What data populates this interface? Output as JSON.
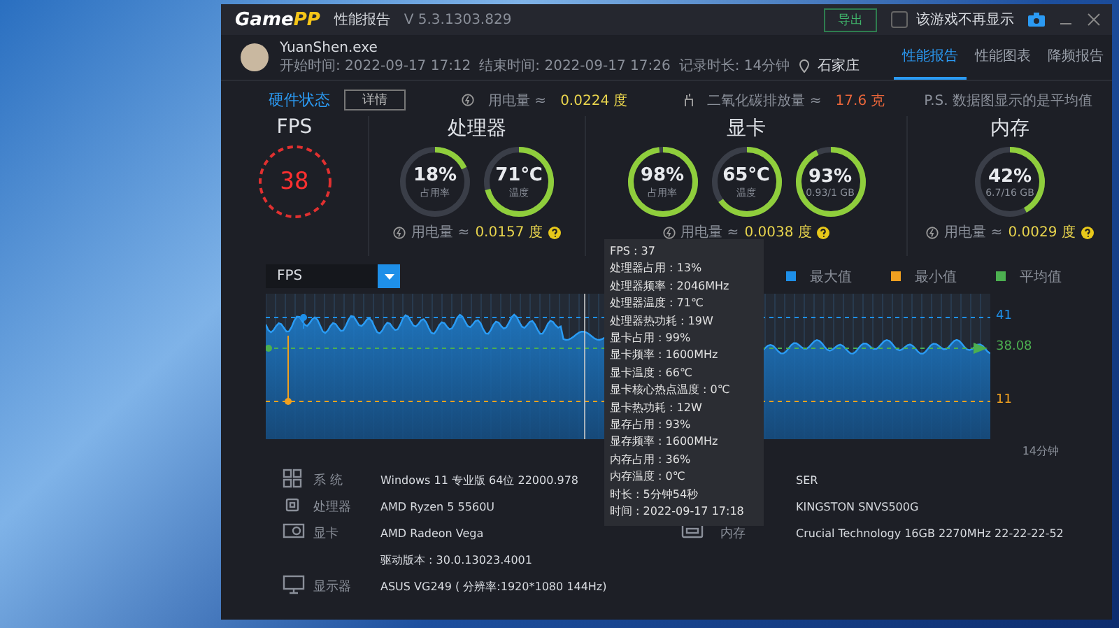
{
  "window": {
    "logo_left": "Game",
    "logo_right": "PP",
    "title": "性能报告",
    "version": "V 5.3.1303.829",
    "export_button": "导出",
    "dont_show": {
      "label": "该游戏不再显示",
      "checked": false
    }
  },
  "session": {
    "exe": "YuanShen.exe",
    "start": "开始时间: 2022-09-17 17:12",
    "end": "结束时间: 2022-09-17 17:26",
    "duration": "记录时长: 14分钟",
    "location": "石家庄"
  },
  "tabs": [
    {
      "label": "性能报告",
      "selected": true
    },
    {
      "label": "性能图表",
      "selected": false
    },
    {
      "label": "降频报告",
      "selected": false
    }
  ],
  "hardware": {
    "title": "硬件状态",
    "details_button": "详情",
    "power_label": "用电量 ≈",
    "power_value": "0.0224 度",
    "co2_label": "二氧化碳排放量 ≈",
    "co2_value": "17.6 克",
    "note": "P.S. 数据图显示的是平均值"
  },
  "fps": {
    "title": "FPS",
    "value": "38"
  },
  "groups": [
    {
      "title": "处理器",
      "power_label": "用电量 ≈",
      "power_value": "0.0157 度",
      "gauges": [
        {
          "value": "18%",
          "caption": "占用率",
          "level": 0.18
        },
        {
          "value": "71℃",
          "caption": "温度",
          "level": 0.71
        }
      ]
    },
    {
      "title": "显卡",
      "power_label": "用电量 ≈",
      "power_value": "0.0038 度",
      "gauges": [
        {
          "value": "98%",
          "caption": "占用率",
          "level": 0.98
        },
        {
          "value": "65℃",
          "caption": "温度",
          "level": 0.65
        },
        {
          "value": "93%",
          "caption": "0.93/1 GB",
          "level": 0.93
        }
      ]
    },
    {
      "title": "内存",
      "power_label": "用电量 ≈",
      "power_value": "0.0029 度",
      "gauges": [
        {
          "value": "42%",
          "caption": "6.7/16 GB",
          "level": 0.42
        }
      ]
    }
  ],
  "chart": {
    "metric": "FPS",
    "legend": [
      {
        "label": "最大值",
        "color": "#1e8fe8"
      },
      {
        "label": "最小值",
        "color": "#f0a020"
      },
      {
        "label": "平均值",
        "color": "#4cb050"
      }
    ],
    "max_label": "41",
    "avg_label": "38.08",
    "min_label": "11",
    "end_label": "14分钟"
  },
  "tooltip": [
    "FPS : 37",
    "处理器占用 : 13%",
    "处理器频率 : 2046MHz",
    "处理器温度 : 71℃",
    "处理器热功耗 : 19W",
    "显卡占用 : 99%",
    "显卡频率 : 1600MHz",
    "显卡温度 : 66℃",
    "显卡核心热点温度 : 0℃",
    "显卡热功耗 : 12W",
    "显存占用 : 93%",
    "显存频率 : 1600MHz",
    "内存占用 : 36%",
    "内存温度 : 0℃",
    "时长 : 5分钟54秒",
    "时间 : 2022-09-17 17:18"
  ],
  "specs_left": [
    {
      "kind": "system",
      "label": "系  统",
      "value": "Windows 11 专业版 64位   22000.978"
    },
    {
      "kind": "cpu",
      "label": "处理器",
      "value": "AMD Ryzen 5 5560U"
    },
    {
      "kind": "gpu",
      "label": "显卡",
      "value": "AMD Radeon Vega"
    },
    {
      "kind": "driver",
      "value": "驱动版本 : 30.0.13023.4001"
    },
    {
      "kind": "display",
      "label": "显示器",
      "value": "ASUS VG249 ( 分辨率:1920*1080 144Hz)"
    }
  ],
  "specs_right": [
    {
      "kind": "board",
      "value": "SER"
    },
    {
      "kind": "disk",
      "value": "KINGSTON SNVS500G"
    },
    {
      "kind": "memory",
      "label": "内存",
      "value": "Crucial Technology 16GB 2270MHz 22-22-22-52"
    }
  ]
}
